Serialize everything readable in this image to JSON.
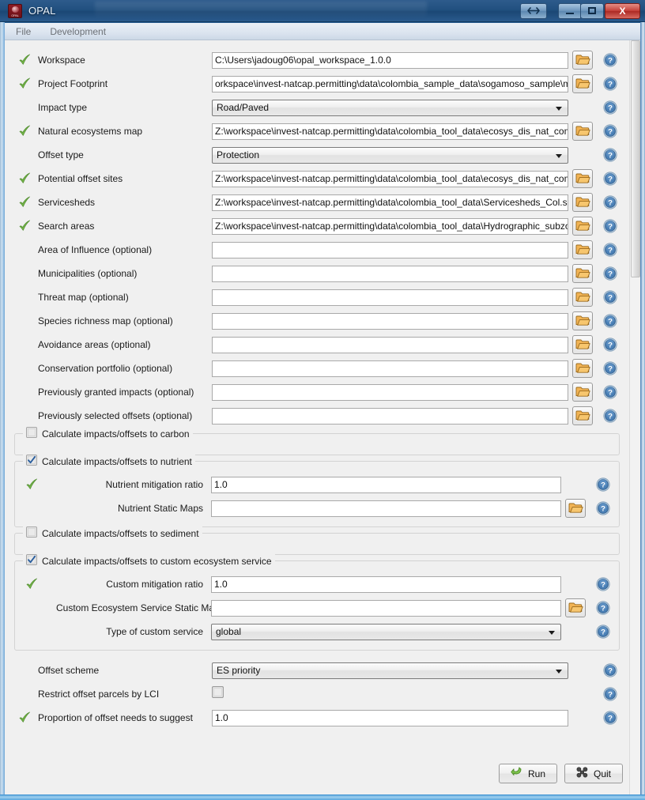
{
  "window": {
    "title": "OPAL",
    "icon": "opal-app-icon",
    "controls": {
      "resize_label": "↔",
      "minimize_label": "–",
      "maximize_label": "□",
      "close_label": "X"
    }
  },
  "menubar": {
    "items": [
      {
        "label": "File"
      },
      {
        "label": "Development"
      }
    ]
  },
  "form": {
    "rows": [
      {
        "valid": true,
        "label": "Workspace",
        "type": "text",
        "value": "C:\\Users\\jadoug06\\opal_workspace_1.0.0",
        "folder": true,
        "help": true
      },
      {
        "valid": true,
        "label": "Project Footprint",
        "type": "text",
        "value": "orkspace\\invest-natcap.permitting\\data\\colombia_sample_data\\sogamoso_sample\\mine_site.shp",
        "folder": true,
        "help": true
      },
      {
        "valid": false,
        "label": "Impact type",
        "type": "combo",
        "value": "Road/Paved",
        "folder": false,
        "help": true
      },
      {
        "valid": true,
        "label": "Natural ecosystems map",
        "type": "text",
        "value": "Z:\\workspace\\invest-natcap.permitting\\data\\colombia_tool_data\\ecosys_dis_nat_comp_fac.shp",
        "folder": true,
        "help": true
      },
      {
        "valid": false,
        "label": "Offset type",
        "type": "combo",
        "value": "Protection",
        "folder": false,
        "help": true
      },
      {
        "valid": true,
        "label": "Potential offset sites",
        "type": "text",
        "value": "Z:\\workspace\\invest-natcap.permitting\\data\\colombia_tool_data\\ecosys_dis_nat_comp_fac.shp",
        "folder": true,
        "help": true
      },
      {
        "valid": true,
        "label": "Servicesheds",
        "type": "text",
        "value": "Z:\\workspace\\invest-natcap.permitting\\data\\colombia_tool_data\\Servicesheds_Col.shp",
        "folder": true,
        "help": true
      },
      {
        "valid": true,
        "label": "Search areas",
        "type": "text",
        "value": "Z:\\workspace\\invest-natcap.permitting\\data\\colombia_tool_data\\Hydrographic_subzones.shp",
        "folder": true,
        "help": true
      },
      {
        "valid": false,
        "label": "Area of Influence (optional)",
        "type": "text",
        "value": "",
        "folder": true,
        "help": true
      },
      {
        "valid": false,
        "label": "Municipalities (optional)",
        "type": "text",
        "value": "",
        "folder": true,
        "help": true
      },
      {
        "valid": false,
        "label": "Threat map (optional)",
        "type": "text",
        "value": "",
        "folder": true,
        "help": true
      },
      {
        "valid": false,
        "label": "Species richness map (optional)",
        "type": "text",
        "value": "",
        "folder": true,
        "help": true
      },
      {
        "valid": false,
        "label": "Avoidance areas (optional)",
        "type": "text",
        "value": "",
        "folder": true,
        "help": true
      },
      {
        "valid": false,
        "label": "Conservation portfolio (optional)",
        "type": "text",
        "value": "",
        "folder": true,
        "help": true
      },
      {
        "valid": false,
        "label": "Previously granted impacts (optional)",
        "type": "text",
        "value": "",
        "folder": true,
        "help": true
      },
      {
        "valid": false,
        "label": "Previously selected offsets (optional)",
        "type": "text",
        "value": "",
        "folder": true,
        "help": true
      }
    ]
  },
  "groups": [
    {
      "id": "carbon",
      "title": "Calculate impacts/offsets to carbon",
      "checked": false,
      "rows": []
    },
    {
      "id": "nutrient",
      "title": "Calculate impacts/offsets to nutrient",
      "checked": true,
      "rows": [
        {
          "valid": true,
          "label": "Nutrient mitigation ratio",
          "type": "text",
          "value": "1.0",
          "folder": false,
          "help": true
        },
        {
          "valid": false,
          "label": "Nutrient Static Maps",
          "type": "text",
          "value": "",
          "folder": true,
          "help": true
        }
      ]
    },
    {
      "id": "sediment",
      "title": "Calculate impacts/offsets to sediment",
      "checked": false,
      "rows": []
    },
    {
      "id": "custom",
      "title": "Calculate impacts/offsets to custom ecosystem service",
      "checked": true,
      "rows": [
        {
          "valid": true,
          "label": "Custom mitigation ratio",
          "type": "text",
          "value": "1.0",
          "folder": false,
          "help": true
        },
        {
          "valid": false,
          "label": "Custom Ecosystem Service Static Maps",
          "type": "text",
          "value": "",
          "folder": true,
          "help": true
        },
        {
          "valid": false,
          "label": "Type of custom service",
          "type": "combo",
          "value": "global",
          "folder": false,
          "help": true
        }
      ]
    }
  ],
  "footer_rows": [
    {
      "valid": false,
      "label": "Offset scheme",
      "type": "combo",
      "value": "ES priority",
      "help": true
    },
    {
      "valid": false,
      "label": "Restrict offset parcels by LCI",
      "type": "checkbox",
      "value": "",
      "checked": false,
      "help": true
    },
    {
      "valid": true,
      "label": "Proportion of offset needs to suggest",
      "type": "text",
      "value": "1.0",
      "help": true
    }
  ],
  "buttons": {
    "run_label": "Run",
    "run_icon": "green-arrow-icon",
    "quit_label": "Quit",
    "quit_icon": "quit-x-icon"
  },
  "colors": {
    "titlebar": "#21507f",
    "close_button": "#c5413a",
    "valid_check": "#6aa84f",
    "folder_icon": "#e8a33d",
    "help_icon": "#4a7fb5",
    "client_bg": "#f0f0f0"
  }
}
